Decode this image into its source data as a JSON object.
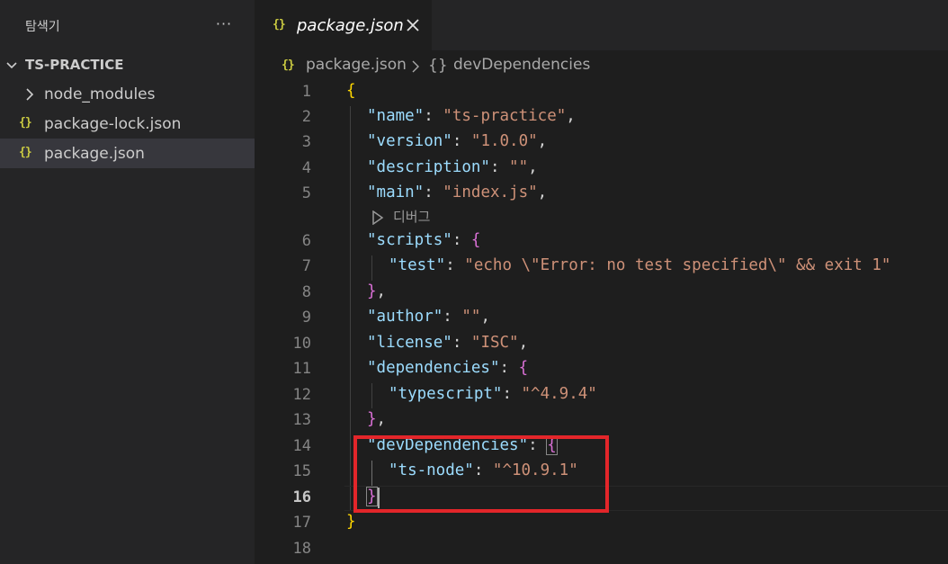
{
  "sidebar": {
    "title": "탐색기",
    "more_actions": "···",
    "project": "TS-PRACTICE",
    "items": [
      {
        "label": "node_modules",
        "type": "folder"
      },
      {
        "label": "package-lock.json",
        "type": "json",
        "icon": "{}"
      },
      {
        "label": "package.json",
        "type": "json",
        "icon": "{}",
        "selected": true
      }
    ]
  },
  "tab": {
    "icon": "{}",
    "label": "package.json",
    "close_icon": "close-icon"
  },
  "breadcrumb": {
    "icon": "{}",
    "file": "package.json",
    "symbol_icon": "{}",
    "symbol": "devDependencies"
  },
  "editor": {
    "codelens": "디버그",
    "current_line": 16,
    "lines": [
      {
        "num": "1"
      },
      {
        "num": "2",
        "key": "\"name\"",
        "val": "\"ts-practice\""
      },
      {
        "num": "3",
        "key": "\"version\"",
        "val": "\"1.0.0\""
      },
      {
        "num": "4",
        "key": "\"description\"",
        "val": "\"\""
      },
      {
        "num": "5",
        "key": "\"main\"",
        "val": "\"index.js\""
      },
      {
        "num": "6",
        "key": "\"scripts\""
      },
      {
        "num": "7",
        "key": "\"test\"",
        "val": "\"echo \\\"Error: no test specified\\\" && exit 1\""
      },
      {
        "num": "8"
      },
      {
        "num": "9",
        "key": "\"author\"",
        "val": "\"\""
      },
      {
        "num": "10",
        "key": "\"license\"",
        "val": "\"ISC\""
      },
      {
        "num": "11",
        "key": "\"dependencies\""
      },
      {
        "num": "12",
        "key": "\"typescript\"",
        "val": "\"^4.9.4\""
      },
      {
        "num": "13"
      },
      {
        "num": "14",
        "key": "\"devDependencies\""
      },
      {
        "num": "15",
        "key": "\"ts-node\"",
        "val": "\"^10.9.1\""
      },
      {
        "num": "16"
      },
      {
        "num": "17"
      },
      {
        "num": "18"
      }
    ]
  },
  "colors": {
    "highlight_box": "#e3262a",
    "json_icon": "#cbcb41",
    "key": "#9cdcfe",
    "string": "#ce9178"
  }
}
